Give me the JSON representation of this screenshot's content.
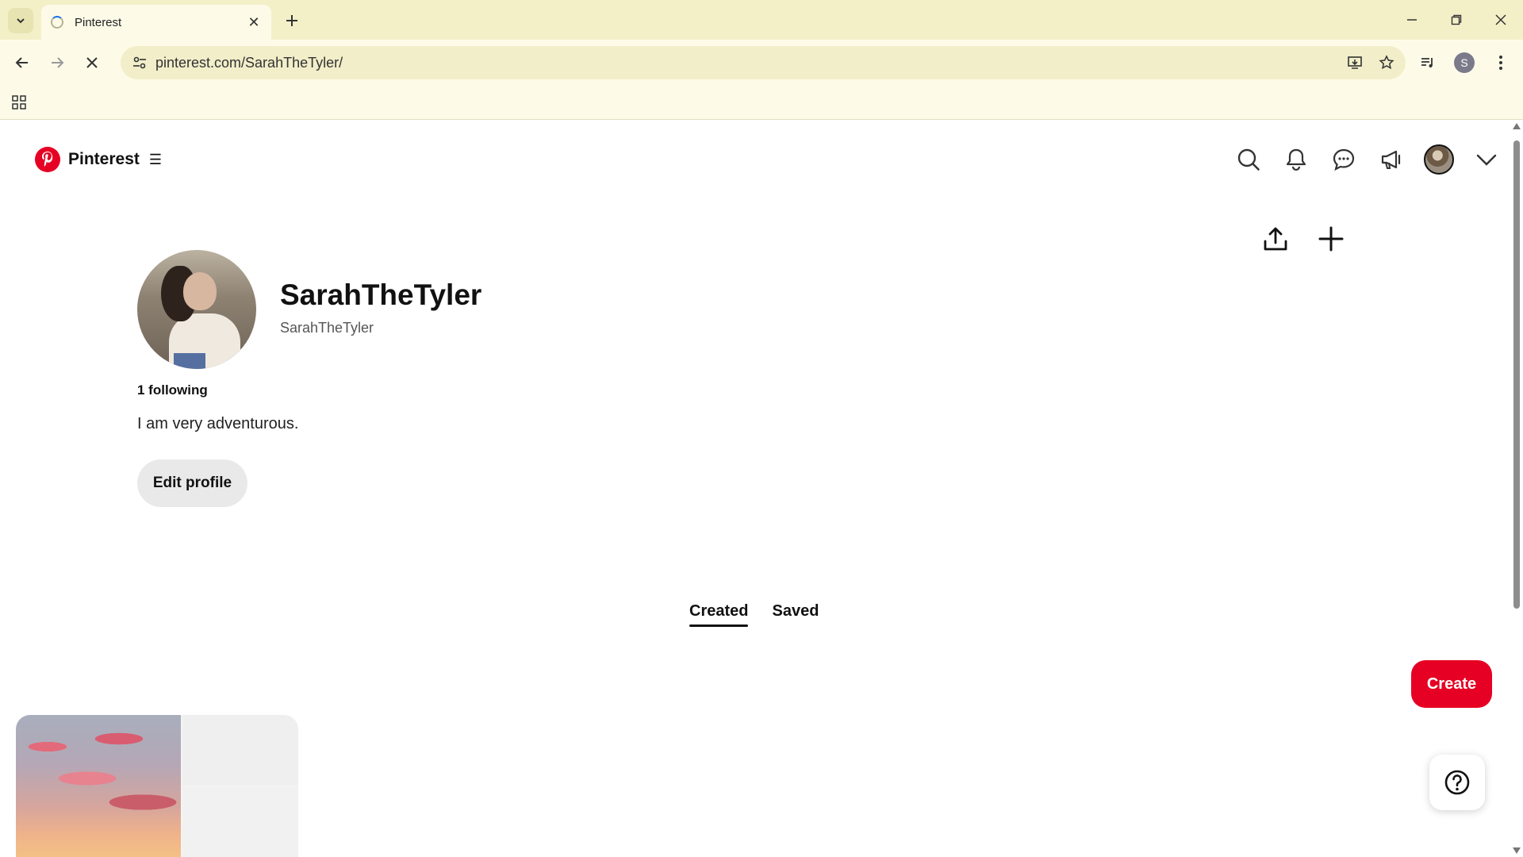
{
  "browser": {
    "tab_title": "Pinterest",
    "url": "pinterest.com/SarahTheTyler/",
    "profile_initial": "S"
  },
  "header": {
    "brand_name": "Pinterest"
  },
  "profile": {
    "display_name": "SarahTheTyler",
    "username": "SarahTheTyler",
    "following": "1 following",
    "bio": "I am very adventurous.",
    "edit_label": "Edit profile"
  },
  "tabs": [
    {
      "label": "Created",
      "active": true
    },
    {
      "label": "Saved",
      "active": false
    }
  ],
  "create_label": "Create",
  "colors": {
    "brand": "#e60023",
    "chrome": "#f3f0c8"
  },
  "icons": [
    "search-icon",
    "bell-icon",
    "chat-icon",
    "megaphone-icon",
    "share-icon",
    "plus-icon",
    "help-icon"
  ]
}
